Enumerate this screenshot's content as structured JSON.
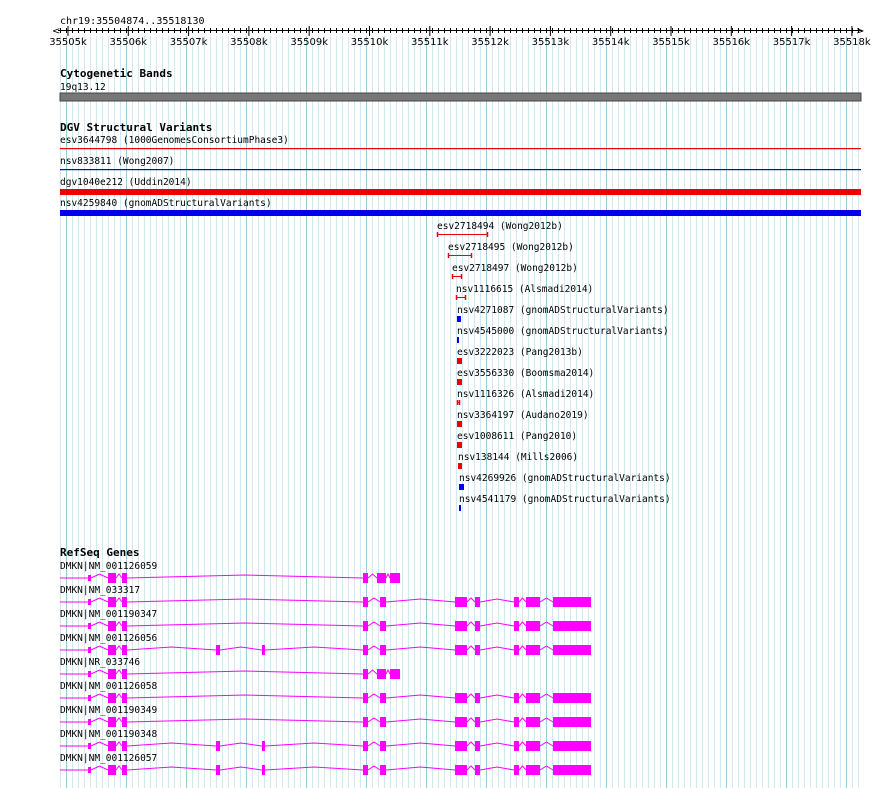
{
  "ruler": {
    "region": "chr19:35504874..35518130",
    "ticks": [
      "35505k",
      "35506k",
      "35507k",
      "35508k",
      "35509k",
      "35510k",
      "35511k",
      "35512k",
      "35513k",
      "35514k",
      "35515k",
      "35516k",
      "35517k",
      "35518k"
    ]
  },
  "cyto": {
    "title": "Cytogenetic Bands",
    "band": "19q13.12",
    "color": "#777777"
  },
  "dgv": {
    "title": "DGV Structural Variants",
    "colors": {
      "loss": "#ee0000",
      "gain": "#0000ee"
    },
    "full_width": [
      {
        "label": "esv3644798 (1000GenomesConsortiumPhase3)",
        "color": "loss",
        "style": "line"
      },
      {
        "label": "nsv833811 (Wong2007)",
        "color": "gain",
        "style": "line"
      },
      {
        "label": "dgv1040e212 (Uddin2014)",
        "color": "loss",
        "style": "bar"
      },
      {
        "label": "nsv4259840 (gnomADStructuralVariants)",
        "color": "gain",
        "style": "bar"
      }
    ],
    "stacked": [
      {
        "label": "esv2718494 (Wong2012b)",
        "color": "loss",
        "style": "interval"
      },
      {
        "label": "esv2718495 (Wong2012b)",
        "color": "loss",
        "style": "interval"
      },
      {
        "label": "esv2718497 (Wong2012b)",
        "color": "loss",
        "style": "interval"
      },
      {
        "label": "nsv1116615 (Alsmadi2014)",
        "color": "loss",
        "style": "interval"
      },
      {
        "label": "nsv4271087 (gnomADStructuralVariants)",
        "color": "gain",
        "style": "block"
      },
      {
        "label": "nsv4545000 (gnomADStructuralVariants)",
        "color": "gain",
        "style": "block"
      },
      {
        "label": "esv3222023 (Pang2013b)",
        "color": "loss",
        "style": "block"
      },
      {
        "label": "esv3556330 (Boomsma2014)",
        "color": "loss",
        "style": "block"
      },
      {
        "label": "nsv1116326 (Alsmadi2014)",
        "color": "loss",
        "style": "interval"
      },
      {
        "label": "nsv3364197 (Audano2019)",
        "color": "loss",
        "style": "block"
      },
      {
        "label": "esv1008611 (Pang2010)",
        "color": "loss",
        "style": "block"
      },
      {
        "label": "nsv138144 (Mills2006)",
        "color": "loss",
        "style": "block"
      },
      {
        "label": "nsv4269926 (gnomADStructuralVariants)",
        "color": "gain",
        "style": "block"
      },
      {
        "label": "nsv4541179 (gnomADStructuralVariants)",
        "color": "gain",
        "style": "block"
      }
    ]
  },
  "refseq": {
    "title": "RefSeq Genes",
    "color": "#ff00ff",
    "transcripts": [
      {
        "label": "DMKN|NM_001126059",
        "model": "short_a"
      },
      {
        "label": "DMKN|NM_033317",
        "model": "long_a"
      },
      {
        "label": "DMKN|NM_001190347",
        "model": "long_a"
      },
      {
        "label": "DMKN|NM_001126056",
        "model": "long_b"
      },
      {
        "label": "DMKN|NR_033746",
        "model": "short_b"
      },
      {
        "label": "DMKN|NM_001126058",
        "model": "long_a"
      },
      {
        "label": "DMKN|NM_001190349",
        "model": "long_a"
      },
      {
        "label": "DMKN|NM_001190348",
        "model": "long_b"
      },
      {
        "label": "DMKN|NM_001126057",
        "model": "long_b"
      }
    ]
  }
}
